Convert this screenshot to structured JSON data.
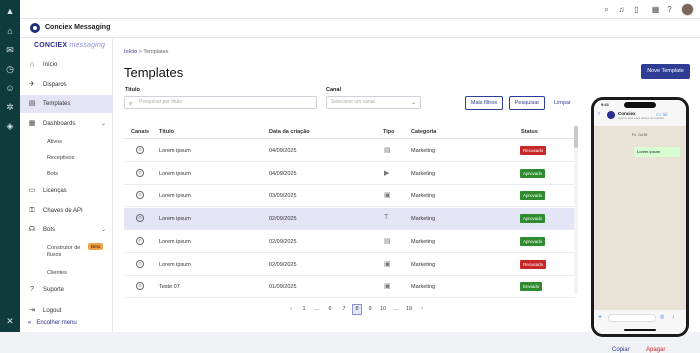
{
  "rail": {
    "icons": [
      "brand-icon",
      "home-icon",
      "mail-icon",
      "clock-icon",
      "user-icon",
      "settings-icon",
      "box-icon",
      "grid-logo-icon"
    ]
  },
  "topbar": {
    "icons": [
      "search-icon",
      "bell-icon",
      "notification-icon",
      "calendar-icon",
      "apps-icon",
      "help-icon"
    ],
    "help_glyph": "?"
  },
  "app": {
    "title": "Conciex Messaging"
  },
  "logo": {
    "main": "CONCIEX",
    "sub": "messaging"
  },
  "sidebar": {
    "items": [
      {
        "label": "Início",
        "icon": "⌂"
      },
      {
        "label": "Disparos",
        "icon": "✈"
      },
      {
        "label": "Templates",
        "icon": "▤"
      },
      {
        "label": "Dashboards",
        "icon": "▦"
      },
      {
        "label": "Licenças",
        "icon": "▭"
      },
      {
        "label": "Chaves de API",
        "icon": "⚿"
      },
      {
        "label": "Bots",
        "icon": "☊"
      },
      {
        "label": "Suporte",
        "icon": "?"
      },
      {
        "label": "Logout",
        "icon": "⇥"
      }
    ],
    "dashboards_sub": [
      "Ativos",
      "Receptivos",
      "Bots"
    ],
    "bots_sub": [
      "Construtor de",
      "fluxos",
      "Clientes"
    ],
    "beta": "Beta",
    "collapse": "Encolher menu",
    "collapse_icon": "«",
    "chevron": "⌄"
  },
  "breadcrumb": {
    "home": "Início",
    "sep": ">",
    "current": "Templates"
  },
  "page": {
    "title": "Templates",
    "new_button": "Nove Template"
  },
  "filters": {
    "title_label": "Titulo",
    "title_placeholder": "Pesquisar por título",
    "channel_label": "Canal",
    "channel_placeholder": "Selecione um canal",
    "more_filters": "Mais filtros",
    "search": "Pesquisar",
    "clear": "Limpar"
  },
  "table": {
    "columns": [
      "Canais",
      "Título",
      "Data da criação",
      "Tipo",
      "Categoria",
      "Status"
    ],
    "rows": [
      {
        "title": "Lorem ipsum",
        "date": "04/09/2025",
        "tipo": "doc",
        "category": "Marketing",
        "status": "Recusado"
      },
      {
        "title": "Lorem ipsum",
        "date": "04/09/2025",
        "tipo": "video",
        "category": "Marketing",
        "status": "Aprovado"
      },
      {
        "title": "Lorem ipsum",
        "date": "03/09/2025",
        "tipo": "image",
        "category": "Marketing",
        "status": "Aprovado"
      },
      {
        "title": "Lorem ipsum",
        "date": "02/09/2025",
        "tipo": "text",
        "category": "Marketing",
        "status": "Aprovado"
      },
      {
        "title": "Lorem ipsum",
        "date": "02/09/2025",
        "tipo": "doc",
        "category": "Marketing",
        "status": "Aprovado"
      },
      {
        "title": "Lorem ipsum",
        "date": "02/09/2025",
        "tipo": "image",
        "category": "Marketing",
        "status": "Recusado"
      },
      {
        "title": "Teste 07",
        "date": "01/09/2025",
        "tipo": "image",
        "category": "Marketing",
        "status": "Enviado"
      }
    ],
    "status_colors": {
      "Recusado": "#c62828",
      "Aprovado": "#2e8b2e",
      "Enviado": "#2e8b2e"
    }
  },
  "pagination": [
    "‹",
    "1",
    "...",
    "6",
    "7",
    "8",
    "9",
    "10",
    "...",
    "19",
    "›"
  ],
  "pagination_current": "8",
  "phone": {
    "time": "9:41",
    "contact": "Conciex",
    "subtitle": "Aperte aqui para dados do contato",
    "day": "Fri, Jul 26",
    "message": "Lorem ipsum",
    "back": "‹",
    "call_icons": "▭ ☏"
  },
  "actions": {
    "copy": "Copiar",
    "delete": "Apagar"
  },
  "colors": {
    "accent": "#2f3d95",
    "rail": "#0f3b3c",
    "selected_row": "#e3e5f7"
  }
}
